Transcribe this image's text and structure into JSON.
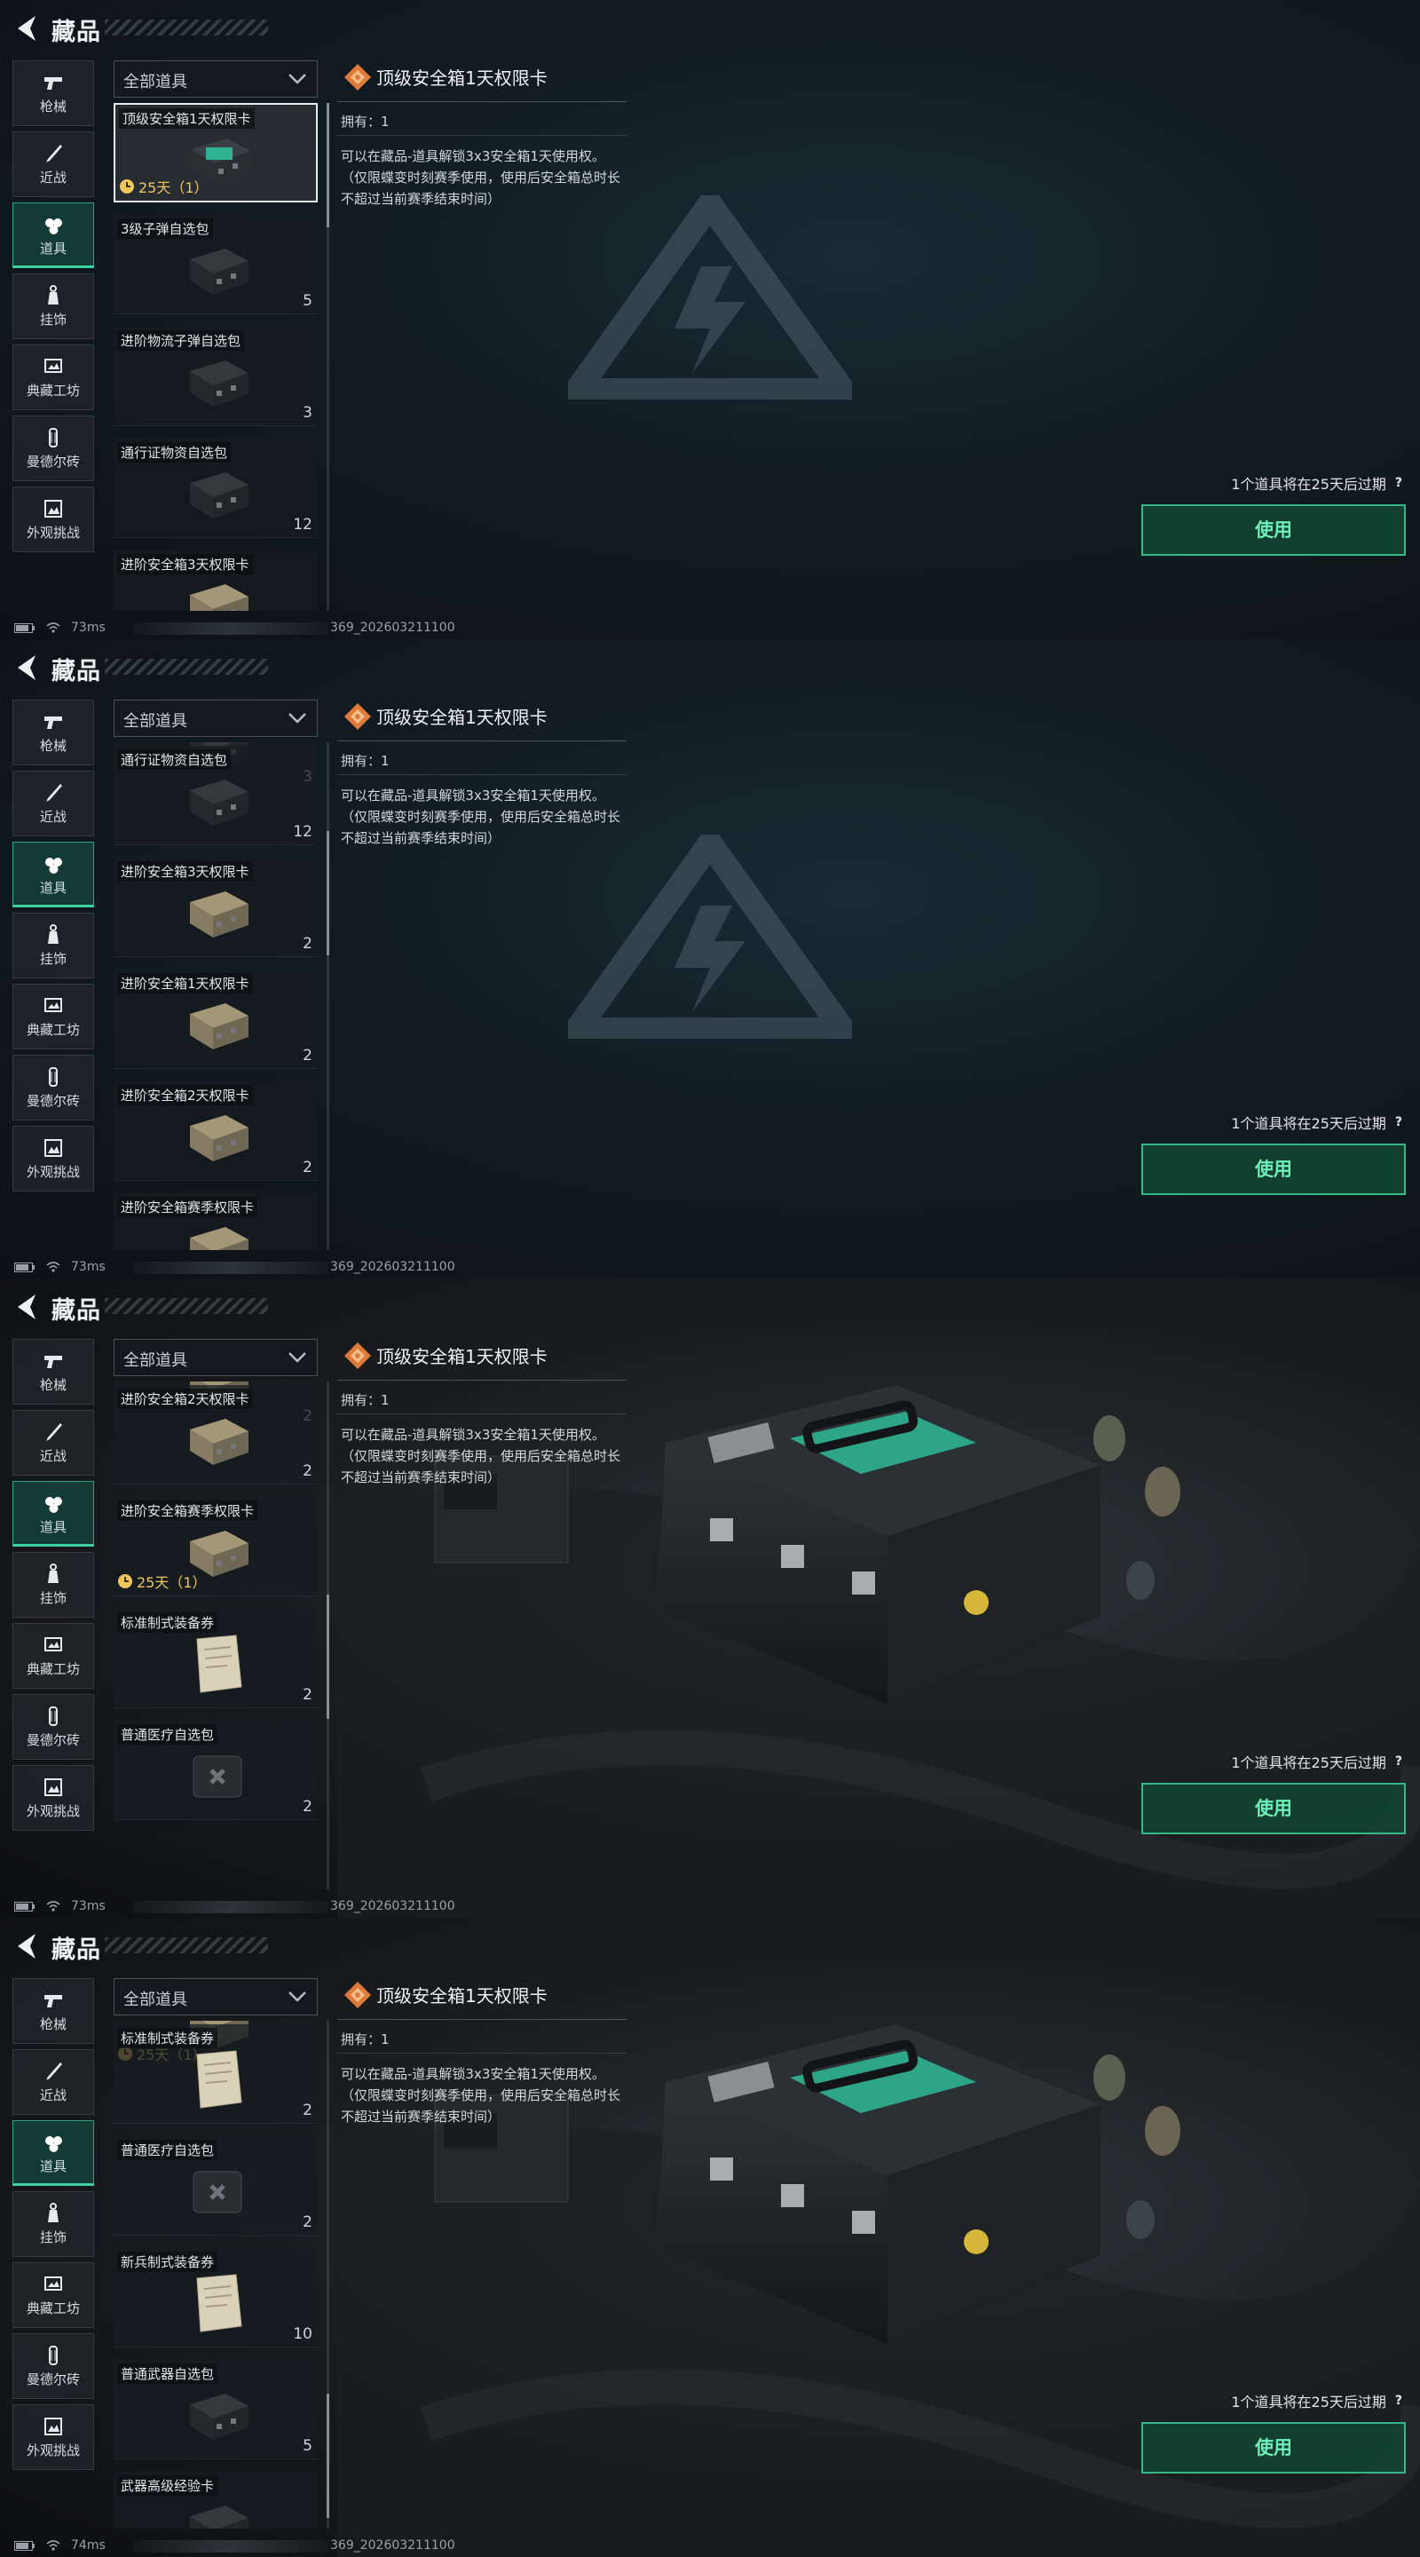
{
  "header": {
    "title": "藏品"
  },
  "nav": {
    "items": [
      {
        "label": "枪械",
        "icon": "pistol-icon"
      },
      {
        "label": "近战",
        "icon": "knife-icon"
      },
      {
        "label": "道具",
        "icon": "items-icon"
      },
      {
        "label": "挂饰",
        "icon": "charm-icon"
      },
      {
        "label": "典藏工坊",
        "icon": "workshop-icon"
      },
      {
        "label": "曼德尔砖",
        "icon": "brick-icon"
      },
      {
        "label": "外观挑战",
        "icon": "challenge-icon"
      }
    ],
    "active_index": 2
  },
  "filter": {
    "label": "全部道具"
  },
  "items": [
    {
      "name": "顶级安全箱1天权限卡",
      "timer": "25天（1）",
      "count": ""
    },
    {
      "name": "3级子弹自选包",
      "count": "5"
    },
    {
      "name": "进阶物流子弹自选包",
      "count": "3"
    },
    {
      "name": "通行证物资自选包",
      "count": "12"
    },
    {
      "name": "进阶安全箱3天权限卡",
      "count": "2"
    },
    {
      "name": "进阶安全箱1天权限卡",
      "count": "2"
    },
    {
      "name": "进阶安全箱2天权限卡",
      "count": "2"
    },
    {
      "name": "进阶安全箱赛季权限卡",
      "timer": "25天（1）",
      "count": ""
    },
    {
      "name": "标准制式装备券",
      "count": "2"
    },
    {
      "name": "普通医疗自选包",
      "count": "2"
    },
    {
      "name": "新兵制式装备券",
      "count": "10"
    },
    {
      "name": "普通武器自选包",
      "count": "5"
    },
    {
      "name": "武器高级经验卡",
      "count": ""
    }
  ],
  "detail": {
    "title": "顶级安全箱1天权限卡",
    "owned": "拥有：1",
    "description": "可以在藏品-道具解锁3x3安全箱1天使用权。（仅限蝶变时刻赛季使用，使用后安全箱总时长不超过当前赛季结束时间）"
  },
  "expiry": {
    "text": "1个道具将在25天后过期",
    "help": "?"
  },
  "use_button": {
    "label": "使用"
  },
  "status": [
    {
      "ping": "73ms",
      "build": "369_202603211100"
    },
    {
      "ping": "73ms",
      "build": "369_202603211100"
    },
    {
      "ping": "73ms",
      "build": "369_202603211100"
    },
    {
      "ping": "74ms",
      "build": "369_202603211100"
    }
  ],
  "colors": {
    "accent": "#3ed2a0",
    "button_text": "#6ff0b8",
    "timer": "#f0c65a",
    "diamond": "#e07a3a"
  }
}
